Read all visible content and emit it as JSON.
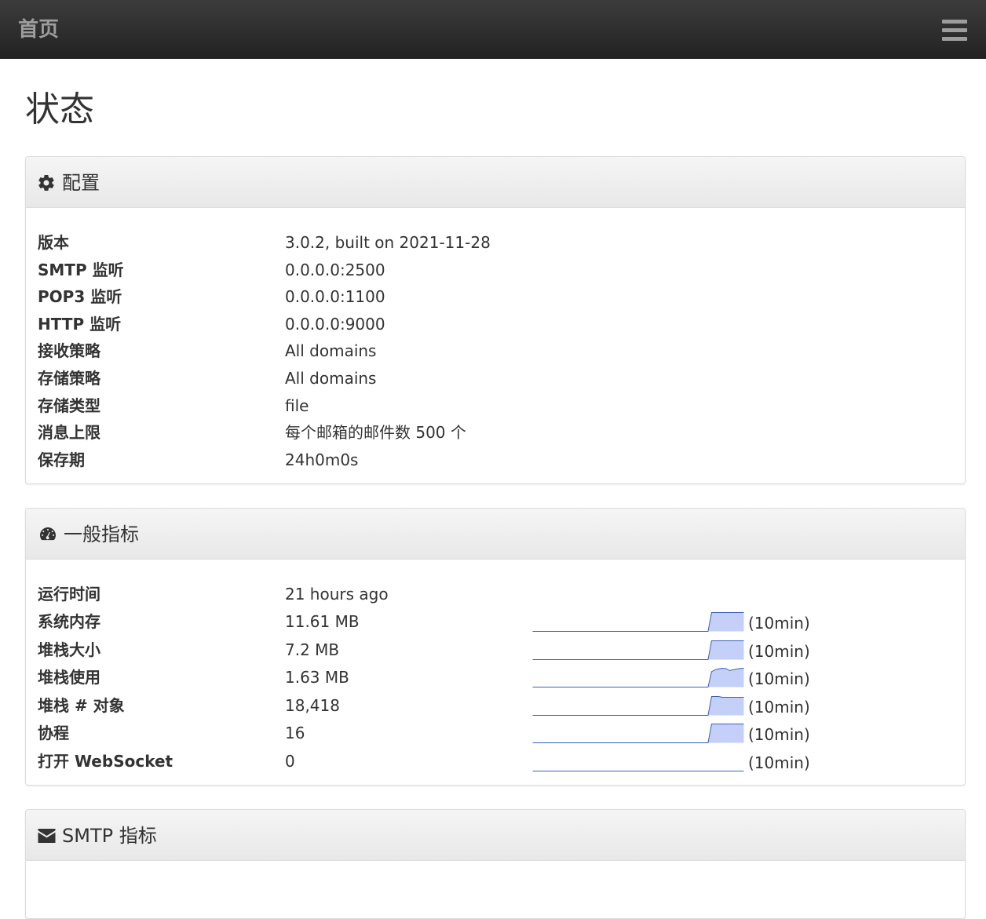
{
  "navbar": {
    "brand": "首页",
    "menu_icon": "hamburger-menu-icon"
  },
  "page": {
    "title": "状态"
  },
  "config_panel": {
    "title": "配置",
    "icon": "gear-icon",
    "rows": [
      {
        "label": "版本",
        "value": "3.0.2, built on 2021-11-28"
      },
      {
        "label": "SMTP 监听",
        "value": "0.0.0.0:2500"
      },
      {
        "label": "POP3 监听",
        "value": "0.0.0.0:1100"
      },
      {
        "label": "HTTP 监听",
        "value": "0.0.0.0:9000"
      },
      {
        "label": "接收策略",
        "value": "All domains"
      },
      {
        "label": "存储策略",
        "value": "All domains"
      },
      {
        "label": "存储类型",
        "value": "file"
      },
      {
        "label": "消息上限",
        "value": "每个邮箱的邮件数 500 个"
      },
      {
        "label": "保存期",
        "value": "24h0m0s"
      }
    ]
  },
  "metrics_panel": {
    "title": "一般指标",
    "icon": "dashboard-gauge-icon",
    "uptime": {
      "label": "运行时间",
      "value": "21 hours ago"
    },
    "rows": [
      {
        "label": "系统内存",
        "value": "11.61 MB",
        "note": "(10min)",
        "sparkline": [
          0,
          0,
          0,
          0,
          0,
          0,
          0,
          0,
          0,
          0,
          0,
          0,
          0,
          0,
          0,
          0,
          0,
          0,
          0,
          0,
          0,
          0,
          0,
          0,
          0,
          0,
          0,
          0,
          0,
          0,
          0,
          0,
          0,
          0,
          0,
          0,
          0,
          0,
          0,
          0,
          0,
          0,
          0,
          0,
          0,
          0,
          0,
          0,
          0,
          0,
          1,
          1,
          1,
          1,
          1,
          1,
          1,
          1,
          1,
          1
        ]
      },
      {
        "label": "堆栈大小",
        "value": "7.2 MB",
        "note": "(10min)",
        "sparkline": [
          0,
          0,
          0,
          0,
          0,
          0,
          0,
          0,
          0,
          0,
          0,
          0,
          0,
          0,
          0,
          0,
          0,
          0,
          0,
          0,
          0,
          0,
          0,
          0,
          0,
          0,
          0,
          0,
          0,
          0,
          0,
          0,
          0,
          0,
          0,
          0,
          0,
          0,
          0,
          0,
          0,
          0,
          0,
          0,
          0,
          0,
          0,
          0,
          0,
          0,
          1,
          1,
          1,
          1,
          1,
          1,
          1,
          1,
          1,
          1
        ]
      },
      {
        "label": "堆栈使用",
        "value": "1.63 MB",
        "note": "(10min)",
        "sparkline": [
          0,
          0,
          0,
          0,
          0,
          0,
          0,
          0,
          0,
          0,
          0,
          0,
          0,
          0,
          0,
          0,
          0,
          0,
          0,
          0,
          0,
          0,
          0,
          0,
          0,
          0,
          0,
          0,
          0,
          0,
          0,
          0,
          0,
          0,
          0,
          0,
          0,
          0,
          0,
          0,
          0,
          0,
          0,
          0,
          0,
          0,
          0,
          0,
          0,
          0,
          0.82,
          0.92,
          0.97,
          1,
          0.98,
          0.88,
          0.92,
          0.96,
          0.99,
          1
        ]
      },
      {
        "label": "堆栈 # 对象",
        "value": "18,418",
        "note": "(10min)",
        "sparkline": [
          0,
          0,
          0,
          0,
          0,
          0,
          0,
          0,
          0,
          0,
          0,
          0,
          0,
          0,
          0,
          0,
          0,
          0,
          0,
          0,
          0,
          0,
          0,
          0,
          0,
          0,
          0,
          0,
          0,
          0,
          0,
          0,
          0,
          0,
          0,
          0,
          0,
          0,
          0,
          0,
          0,
          0,
          0,
          0,
          0,
          0,
          0,
          0,
          0,
          0,
          1,
          1,
          1,
          0.96,
          0.96,
          0.96,
          0.96,
          0.96,
          0.96,
          0.96
        ]
      },
      {
        "label": "协程",
        "value": "16",
        "note": "(10min)",
        "sparkline": [
          0,
          0,
          0,
          0,
          0,
          0,
          0,
          0,
          0,
          0,
          0,
          0,
          0,
          0,
          0,
          0,
          0,
          0,
          0,
          0,
          0,
          0,
          0,
          0,
          0,
          0,
          0,
          0,
          0,
          0,
          0,
          0,
          0,
          0,
          0,
          0,
          0,
          0,
          0,
          0,
          0,
          0,
          0,
          0,
          0,
          0,
          0,
          0,
          0,
          0,
          1,
          1,
          1,
          1,
          1,
          1,
          1,
          1,
          1,
          1
        ]
      },
      {
        "label": "打开 WebSocket",
        "value": "0",
        "note": "(10min)",
        "sparkline": [
          0,
          0,
          0,
          0,
          0,
          0,
          0,
          0,
          0,
          0,
          0,
          0,
          0,
          0,
          0,
          0,
          0,
          0,
          0,
          0,
          0,
          0,
          0,
          0,
          0,
          0,
          0,
          0,
          0,
          0,
          0,
          0,
          0,
          0,
          0,
          0,
          0,
          0,
          0,
          0,
          0,
          0,
          0,
          0,
          0,
          0,
          0,
          0,
          0,
          0,
          0,
          0,
          0,
          0,
          0,
          0,
          0,
          0,
          0,
          0
        ]
      }
    ]
  },
  "smtp_panel": {
    "title": "SMTP 指标",
    "icon": "envelope-icon"
  },
  "colors": {
    "navbar": "#222222",
    "sparkline_line": "#3b5fc0",
    "sparkline_fill": "#c4d0f7"
  }
}
